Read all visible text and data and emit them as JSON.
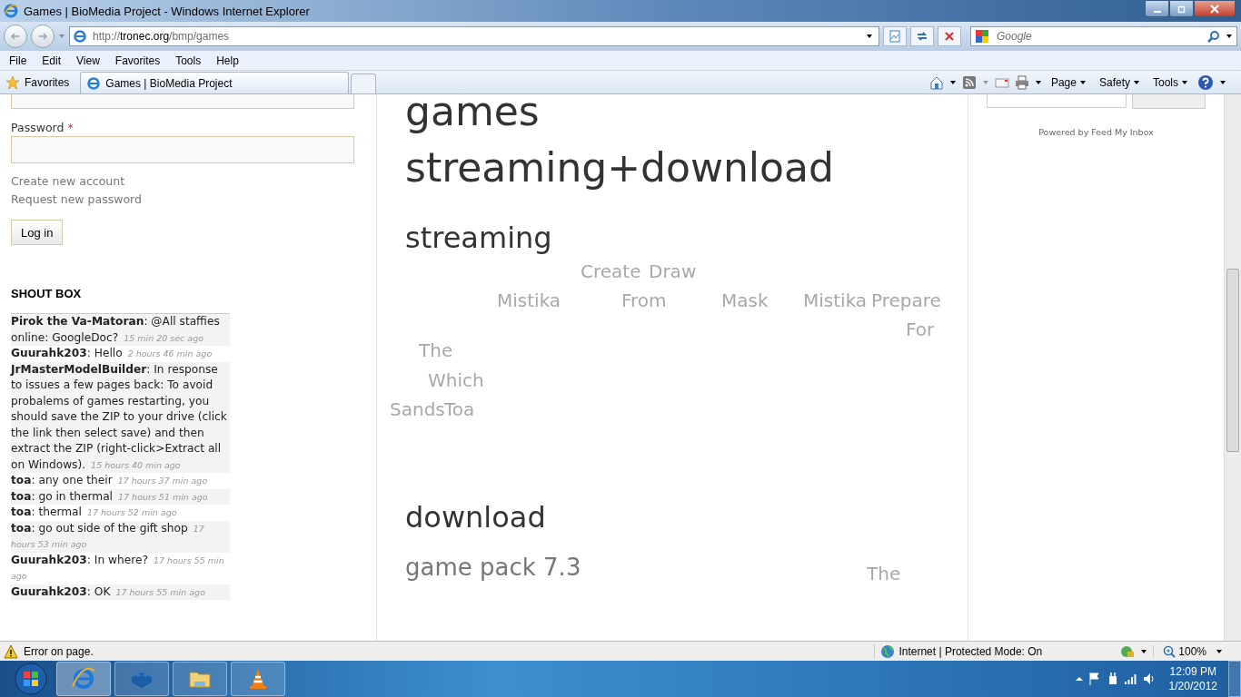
{
  "window": {
    "title": "Games | BioMedia Project - Windows Internet Explorer"
  },
  "address_bar": {
    "url_prefix": "http://",
    "url_domain": "tronec.org",
    "url_path": "/bmp/games"
  },
  "search": {
    "placeholder": "Google"
  },
  "menu": [
    "File",
    "Edit",
    "View",
    "Favorites",
    "Tools",
    "Help"
  ],
  "favorites": {
    "label": "Favorites"
  },
  "tabs": [
    {
      "label": "Games | BioMedia Project",
      "selected": true
    }
  ],
  "command_bar": [
    "Page",
    "Safety",
    "Tools"
  ],
  "login": {
    "password_label": "Password",
    "required_mark": "*",
    "links": [
      "Create new account",
      "Request new password"
    ],
    "button": "Log in"
  },
  "shoutbox": {
    "title": "SHOUT BOX",
    "shouts": [
      {
        "text": "**Pirok the Va-Matoran**: @All staffies online: GoogleDoc?",
        "time": "15 min 20 sec ago"
      },
      {
        "text": "**Guurahk203**: Hello",
        "time": "2 hours 46 min ago"
      },
      {
        "text": "**JrMasterModelBuilder**: In response to issues a few pages back: To avoid probalems of games restarting, you should save the ZIP to your drive (click the link then select save) and then extract the ZIP (right-click>Extract all on Windows).",
        "time": "15 hours 40 min ago"
      },
      {
        "text": "**toa**: any one their",
        "time": "17 hours 37 min ago"
      },
      {
        "text": "**toa**: go in thermal",
        "time": "17 hours 51 min ago"
      },
      {
        "text": "**toa**: thermal",
        "time": "17 hours 52 min ago"
      },
      {
        "text": "**toa**: go out side of the gift shop",
        "time": "17 hours 53 min ago"
      },
      {
        "text": "**Guurahk203**: In where?",
        "time": "17 hours 55 min ago"
      },
      {
        "text": "**Guurahk203**: OK",
        "time": "17 hours 55 min ago"
      }
    ]
  },
  "main": {
    "title": "games",
    "subtitle": "streaming+download",
    "streaming_heading": "streaming",
    "game_titles": [
      "Create",
      "Draw",
      "Mistika",
      "From",
      "Mask",
      "Mistika",
      "Prepare",
      "For",
      "The",
      "Which",
      "Sands",
      "Toa"
    ],
    "download_heading": "download",
    "pack_title": "game pack 7.3",
    "trailing_title": "The"
  },
  "right_sidebar": {
    "powered_by": "Powered by Feed My Inbox"
  },
  "status_bar": {
    "message": "Error on page.",
    "zone": "Internet | Protected Mode: On",
    "zoom": "100%"
  },
  "taskbar": {
    "time": "12:09 PM",
    "date": "1/20/2012"
  }
}
